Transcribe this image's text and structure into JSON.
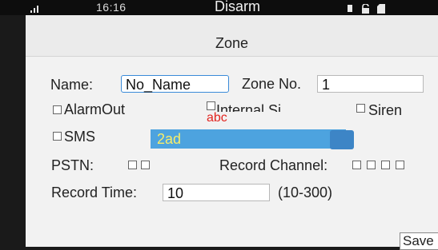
{
  "statusbar": {
    "time": "16:16",
    "mode": "Disarm",
    "icons": [
      "signal-icon",
      "device-icon",
      "lock-icon",
      "sd-card-icon"
    ]
  },
  "page": {
    "title": "Zone"
  },
  "form": {
    "name_label": "Name:",
    "name_value": "No_Name",
    "zone_no_label": "Zone No.",
    "zone_no_value": "1",
    "alarm_out_label": "AlarmOut",
    "internal_siren_label": "Internal Si",
    "siren_label": "Siren",
    "sms_label": "SMS",
    "pstn_label": "PSTN:",
    "record_channel_label": "Record Channel:",
    "record_time_label": "Record Time:",
    "record_time_value": "10",
    "record_time_range": "(10-300)",
    "save_label": "Save"
  },
  "ime": {
    "mode_hint": "abc",
    "composition": "2ad",
    "bar_color": "#4da3df",
    "text_color": "#f7ed6a",
    "hint_color": "#e2241f"
  },
  "colors": {
    "focus_border": "#3a8ad8",
    "panel_bg": "#f2f2f2"
  }
}
